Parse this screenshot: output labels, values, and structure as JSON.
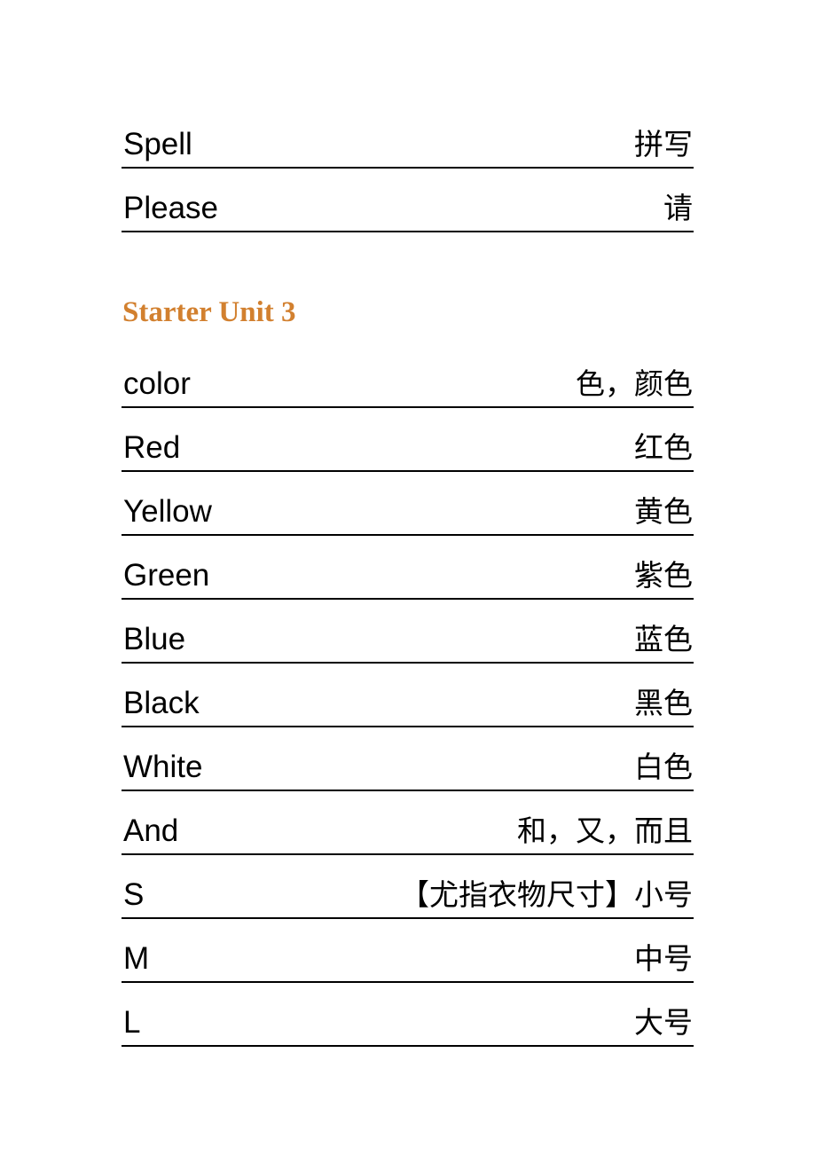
{
  "document": {
    "title": "Starter Unit vocabulary list",
    "heading_color": "#D2802F",
    "rule_color": "#000000",
    "text_color": "#000000"
  },
  "sections": [
    {
      "id": "continued-rows",
      "heading": null,
      "rows": [
        {
          "term": "Spell",
          "gloss": "拼写"
        },
        {
          "term": "Please",
          "gloss": "请"
        }
      ]
    },
    {
      "id": "starter-unit-3",
      "heading": "Starter Unit 3",
      "rows": [
        {
          "term": "color",
          "gloss": "色，颜色"
        },
        {
          "term": "Red",
          "gloss": "红色"
        },
        {
          "term": "Yellow",
          "gloss": "黄色"
        },
        {
          "term": "Green",
          "gloss": "紫色"
        },
        {
          "term": "Blue",
          "gloss": "蓝色"
        },
        {
          "term": "Black",
          "gloss": "黑色"
        },
        {
          "term": "White",
          "gloss": "白色"
        },
        {
          "term": "And",
          "gloss": "和，又，而且"
        },
        {
          "term": "S",
          "gloss": "【尤指衣物尺寸】小号"
        },
        {
          "term": "M",
          "gloss": "中号"
        },
        {
          "term": "L",
          "gloss": "大号"
        }
      ]
    }
  ]
}
